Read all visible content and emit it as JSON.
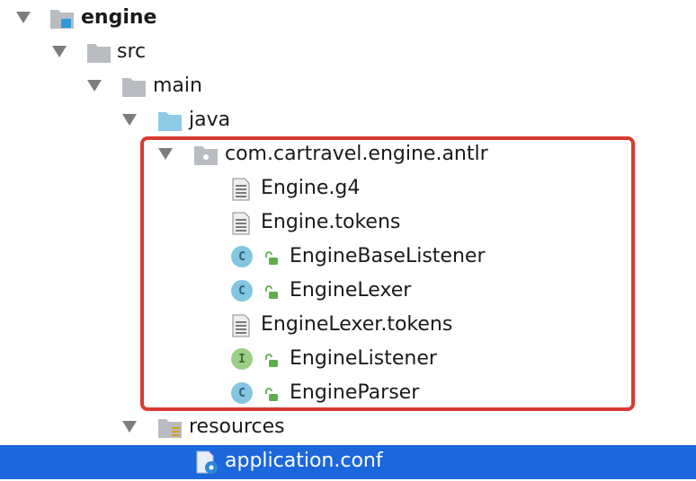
{
  "tree": {
    "root": {
      "label": "engine",
      "icon": "module-folder-icon"
    },
    "src": {
      "label": "src",
      "icon": "folder-icon"
    },
    "main": {
      "label": "main",
      "icon": "folder-icon"
    },
    "java": {
      "label": "java",
      "icon": "source-folder-icon"
    },
    "package": {
      "label": "com.cartravel.engine.antlr",
      "icon": "package-icon"
    },
    "files": [
      {
        "label": "Engine.g4",
        "icon": "text-file-icon"
      },
      {
        "label": "Engine.tokens",
        "icon": "text-file-icon"
      },
      {
        "label": "EngineBaseListener",
        "icon": "class-icon",
        "badge": "C"
      },
      {
        "label": "EngineLexer",
        "icon": "class-icon",
        "badge": "C"
      },
      {
        "label": "EngineLexer.tokens",
        "icon": "text-file-icon"
      },
      {
        "label": "EngineListener",
        "icon": "interface-icon",
        "badge": "I"
      },
      {
        "label": "EngineParser",
        "icon": "class-icon",
        "badge": "C"
      }
    ],
    "resources": {
      "label": "resources",
      "icon": "resources-folder-icon"
    },
    "config": {
      "label": "application.conf",
      "icon": "config-file-icon",
      "selected": true
    }
  },
  "colors": {
    "selection": "#1d67dd",
    "highlight_border": "#d93a30",
    "class_badge": "#84c5e0",
    "interface_badge": "#9bcf87",
    "folder_gray": "#b9bdc2",
    "source_folder_blue": "#8ecbe6"
  }
}
